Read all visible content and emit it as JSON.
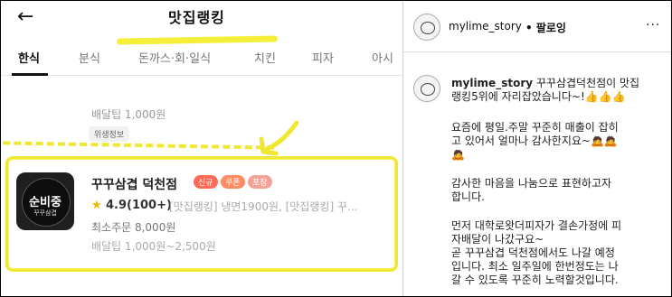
{
  "header": {
    "back_icon": "←",
    "title": "맛집랭킹"
  },
  "tabs": [
    "한식",
    "분식",
    "돈까스·회·일식",
    "치킨",
    "피자",
    "아시"
  ],
  "previous_item": {
    "delivery_fee": "배달팁 1,000원",
    "badge": "위생정보"
  },
  "store": {
    "logo_text": "순비중",
    "logo_sub": "꾸꾸삼겹",
    "name": "꾸꾸삼겹 덕천점",
    "badges": [
      {
        "label": "신규",
        "color": "#ff6b57"
      },
      {
        "label": "쿠폰",
        "color": "#ff8b60"
      },
      {
        "label": "포장",
        "color": "#f3a29a"
      }
    ],
    "star": "★",
    "rating": "4.9(100+)",
    "tags": "[맛집랭킹] 냉면1900원, [맛집랭킹] 꾸...",
    "min_order": "최소주문 8,000원",
    "delivery_fee": "배달팁 1,000원~2,500원"
  },
  "post": {
    "username": "mylime_story",
    "follow": "• 팔로잉",
    "more_icon": "···",
    "caption_user": "mylime_story",
    "lines": [
      " 꾸꾸삼겹덕천점이 맛집",
      "랭킹5위에 자리잡았습니다~!👍👍👍",
      "요즘에 평일.주말 꾸준히 매출이 잡히",
      "고 있어서 얼마나 감사한지요~🙇🙇",
      "🙇",
      "감사한 마음을 나눔으로 표현하고자",
      "합니다.",
      "먼저 대학로왓더피자가 결손가정에 피",
      "자배달이 나갔구요~",
      "곧 꾸꾸삼겹 덕천점에서도 나갈 예정",
      "입니다. 최소 일주일에 한번정도는 나",
      "갈 수 있도록 꾸준히 노력할것입니다."
    ]
  },
  "colors": {
    "highlight": "#f0e830",
    "star": "#f3b400"
  }
}
